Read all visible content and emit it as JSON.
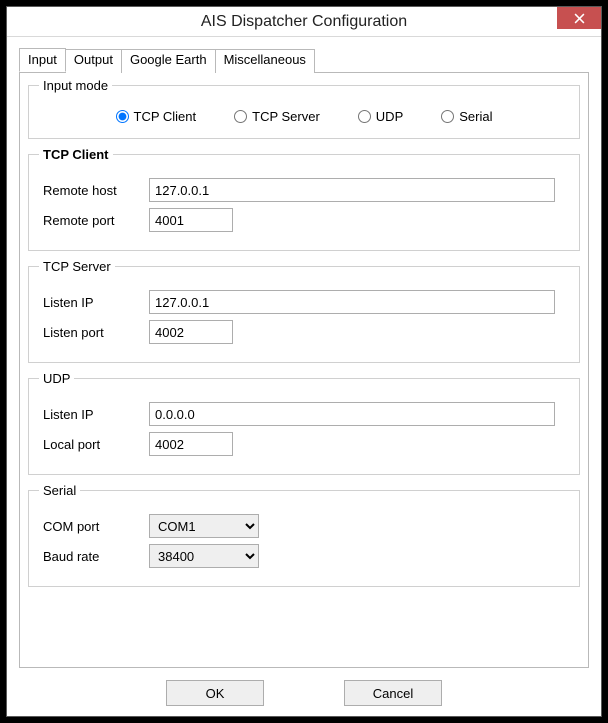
{
  "window": {
    "title": "AIS Dispatcher Configuration"
  },
  "tabs": {
    "input": "Input",
    "output": "Output",
    "google_earth": "Google Earth",
    "misc": "Miscellaneous"
  },
  "input_mode": {
    "legend": "Input mode",
    "options": {
      "tcp_client": "TCP Client",
      "tcp_server": "TCP Server",
      "udp": "UDP",
      "serial": "Serial"
    },
    "selected": "tcp_client"
  },
  "tcp_client": {
    "legend": "TCP Client",
    "remote_host_label": "Remote host",
    "remote_host": "127.0.0.1",
    "remote_port_label": "Remote port",
    "remote_port": "4001"
  },
  "tcp_server": {
    "legend": "TCP Server",
    "listen_ip_label": "Listen IP",
    "listen_ip": "127.0.0.1",
    "listen_port_label": "Listen port",
    "listen_port": "4002"
  },
  "udp": {
    "legend": "UDP",
    "listen_ip_label": "Listen IP",
    "listen_ip": "0.0.0.0",
    "local_port_label": "Local port",
    "local_port": "4002"
  },
  "serial": {
    "legend": "Serial",
    "com_port_label": "COM port",
    "com_port": "COM1",
    "baud_rate_label": "Baud rate",
    "baud_rate": "38400"
  },
  "buttons": {
    "ok": "OK",
    "cancel": "Cancel"
  }
}
